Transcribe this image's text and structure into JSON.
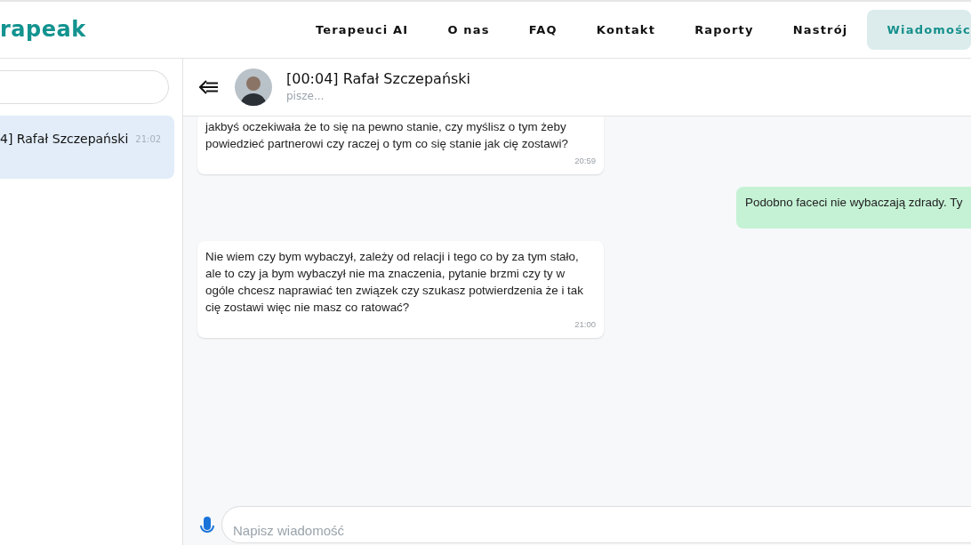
{
  "brand": {
    "text": "rapeak"
  },
  "nav": [
    {
      "label": "Terapeuci AI",
      "selected": false
    },
    {
      "label": "O nas",
      "selected": false
    },
    {
      "label": "FAQ",
      "selected": false
    },
    {
      "label": "Kontakt",
      "selected": false
    },
    {
      "label": "Raporty",
      "selected": false
    },
    {
      "label": "Nastrój",
      "selected": false
    },
    {
      "label": "Wiadomośc",
      "selected": true
    }
  ],
  "conversations": [
    {
      "name": "4] Rafał Szczepański",
      "time": "21:02",
      "selected": true
    }
  ],
  "chat": {
    "title": "[00:04] Rafał Szczepański",
    "status": "pisze...",
    "messages": [
      {
        "outgoing": false,
        "text": "jakbyś oczekiwała że to się na pewno stanie, czy myślisz o tym żeby powiedzieć partnerowi czy raczej o tym co się stanie jak cię zostawi?",
        "time": "20:59"
      },
      {
        "outgoing": true,
        "text": "Podobno faceci nie wybaczają zdrady. Ty"
      },
      {
        "outgoing": false,
        "text": "Nie wiem czy bym wybaczył, zależy od relacji i tego co by za tym stało, ale to czy ja bym wybaczył nie ma znaczenia, pytanie brzmi czy ty w ogóle chcesz naprawiać ten związek czy szukasz potwierdzenia że i tak cię zostawi więc nie masz co ratować?",
        "time": "21:00"
      }
    ],
    "input": {
      "placeholder": "Napisz wiadomość"
    }
  }
}
